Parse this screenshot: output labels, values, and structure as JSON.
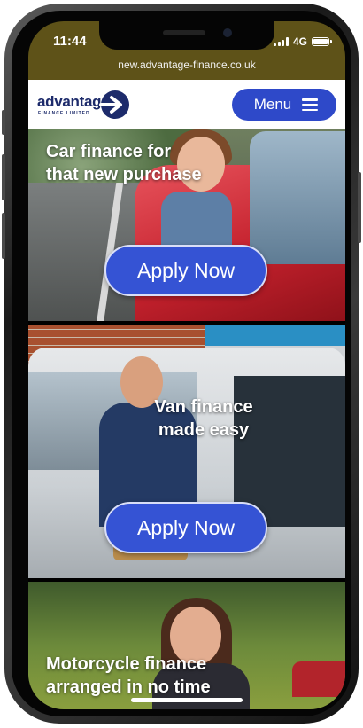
{
  "status_bar": {
    "time": "11:44",
    "network": "4G",
    "url": "new.advantage-finance.co.uk"
  },
  "header": {
    "logo_text": "advantage",
    "logo_subtext": "FINANCE LIMITED",
    "menu_label": "Menu"
  },
  "hero_panels": [
    {
      "title_line1": "Car finance for",
      "title_line2": "that new purchase",
      "button_label": "Apply Now"
    },
    {
      "title_line1": "Van finance",
      "title_line2": "made easy",
      "button_label": "Apply Now"
    },
    {
      "title_line1": "Motorcycle finance",
      "title_line2": "arranged in no time"
    }
  ],
  "colors": {
    "brand_blue": "#2e49c9",
    "brand_navy": "#1d2b6b",
    "url_bar": "#5e5218"
  }
}
